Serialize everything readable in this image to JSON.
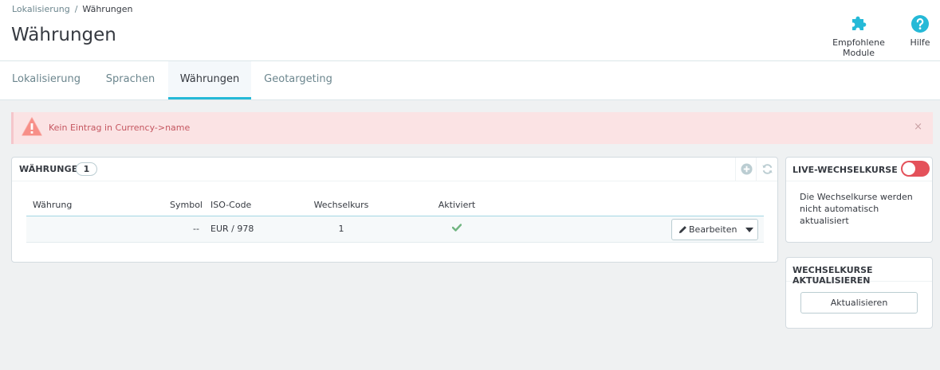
{
  "breadcrumb": {
    "parent": "Lokalisierung",
    "separator": "/",
    "current": "Währungen"
  },
  "page_title": "Währungen",
  "toolbar": {
    "modules_label": "Empfohlene Module",
    "help_label": "Hilfe",
    "modules_icon": "puzzle-icon",
    "help_icon": "question-circle-icon",
    "icon_color": "#25b9d7"
  },
  "tabs": [
    {
      "label": "Lokalisierung",
      "active": false
    },
    {
      "label": "Sprachen",
      "active": false
    },
    {
      "label": "Währungen",
      "active": true
    },
    {
      "label": "Geotargeting",
      "active": false
    }
  ],
  "alert": {
    "message": "Kein Eintrag in Currency->name",
    "close": "×",
    "icon": "warning-triangle-icon",
    "color": "#f54c3e"
  },
  "currency_panel": {
    "title": "WÄHRUNGEN",
    "count": "1",
    "columns": {
      "name": "Währung",
      "symbol": "Symbol",
      "iso": "ISO-Code",
      "rate": "Wechselkurs",
      "active": "Aktiviert"
    },
    "rows": [
      {
        "name": "",
        "symbol": "--",
        "iso": "EUR / 978",
        "rate": "1",
        "active": true,
        "edit_label": "Bearbeiten"
      }
    ]
  },
  "live_panel": {
    "title": "LIVE-WECHSELKURSE",
    "enabled": false,
    "text": "Die Wechselkurse werden nicht automatisch aktualisiert"
  },
  "update_panel": {
    "title": "WECHSELKURSE AKTUALISIEREN",
    "button_label": "Aktualisieren"
  }
}
